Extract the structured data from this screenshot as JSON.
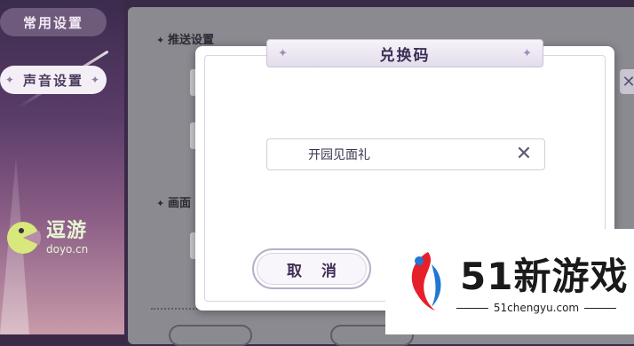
{
  "sidebar": {
    "items": [
      {
        "label": "常用设置"
      },
      {
        "label": "声音设置"
      }
    ]
  },
  "settings": {
    "section_push": "推送设置",
    "section_graphics": "画面"
  },
  "dialog": {
    "title": "兑换码",
    "input_value": "开园见面礼",
    "cancel_label": "取 消"
  },
  "watermarks": {
    "doyo_cn": "逗游",
    "doyo_en": "doyo.cn",
    "brand_name": "51新游戏",
    "brand_url": "51chengyu.com"
  },
  "colors": {
    "accent": "#3e2f56",
    "overlay": "#8a8a90"
  }
}
